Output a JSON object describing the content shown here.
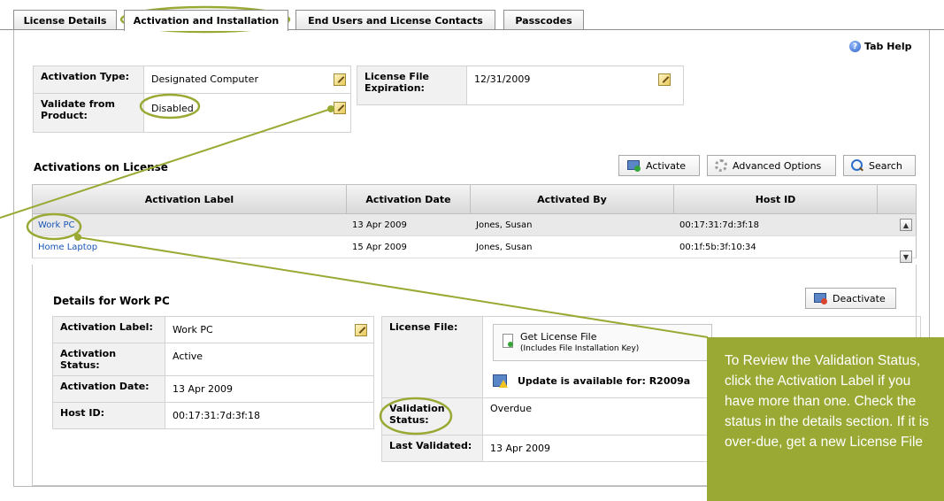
{
  "tabs": [
    {
      "label": "License Details"
    },
    {
      "label": "Activation and Installation"
    },
    {
      "label": "End Users and License Contacts"
    },
    {
      "label": "Passcodes"
    }
  ],
  "tab_help": "Tab Help",
  "license": {
    "activation_type_label": "Activation Type:",
    "activation_type_value": "Designated Computer",
    "validate_label": "Validate from Product:",
    "validate_value": "Disabled",
    "expiration_label": "License File Expiration:",
    "expiration_value": "12/31/2009"
  },
  "activations": {
    "title": "Activations on License",
    "buttons": {
      "activate": "Activate",
      "advanced": "Advanced Options",
      "search": "Search"
    },
    "columns": [
      "Activation Label",
      "Activation Date",
      "Activated By",
      "Host ID"
    ],
    "rows": [
      {
        "label": "Work PC",
        "date": "13 Apr 2009",
        "by": "Jones, Susan",
        "host": "00:17:31:7d:3f:18"
      },
      {
        "label": "Home Laptop",
        "date": "15 Apr 2009",
        "by": "Jones, Susan",
        "host": "00:1f:5b:3f:10:34"
      }
    ]
  },
  "details": {
    "title": "Details for Work PC",
    "deactivate": "Deactivate",
    "activation_label_label": "Activation Label:",
    "activation_label_value": "Work PC",
    "status_label": "Activation Status:",
    "status_value": "Active",
    "date_label": "Activation Date:",
    "date_value": "13 Apr 2009",
    "host_label": "Host ID:",
    "host_value": "00:17:31:7d:3f:18",
    "license_file_label": "License File:",
    "get_license": "Get License File",
    "get_license_sub": "(Includes File Installation Key)",
    "update_text": "Update is available for: R2009a",
    "validation_label": "Validation Status:",
    "validation_value": "Overdue",
    "last_validated_label": "Last Validated:",
    "last_validated_value": "13 Apr 2009"
  },
  "callout": "To Review the Validation Status, click the Activation Label if you have more than one. Check the status in the details section. If it is over-due, get a new License File",
  "colors": {
    "annotation": "#9aa934",
    "link": "#1a56b8"
  }
}
